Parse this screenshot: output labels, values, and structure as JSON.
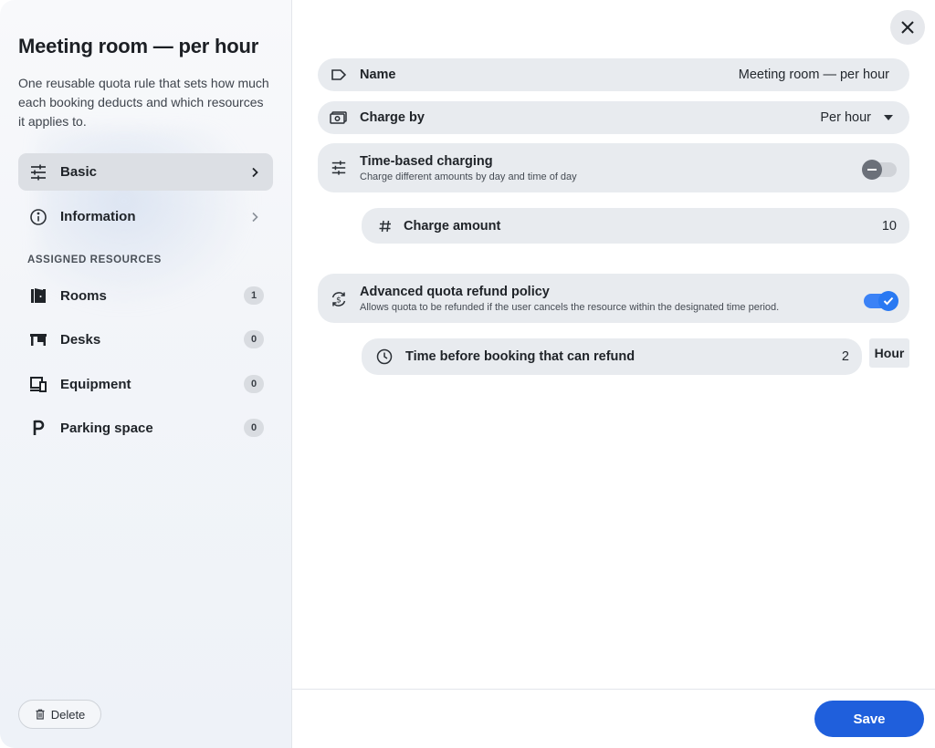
{
  "sidebar": {
    "title": "Meeting room — per hour",
    "description": "One reusable quota rule that sets how much each booking deducts and which resources it applies to.",
    "nav": [
      {
        "label": "Basic",
        "icon": "sliders-icon",
        "active": true
      },
      {
        "label": "Information",
        "icon": "info-icon",
        "active": false
      }
    ],
    "section_label": "ASSIGNED RESOURCES",
    "resources": [
      {
        "label": "Rooms",
        "count": "1",
        "icon": "door-icon"
      },
      {
        "label": "Desks",
        "count": "0",
        "icon": "desk-icon"
      },
      {
        "label": "Equipment",
        "count": "0",
        "icon": "devices-icon"
      },
      {
        "label": "Parking space",
        "count": "0",
        "icon": "parking-icon"
      }
    ],
    "delete_label": "Delete"
  },
  "form": {
    "name_label": "Name",
    "name_value": "Meeting room — per hour",
    "charge_by_label": "Charge by",
    "charge_by_value": "Per hour",
    "time_based_label": "Time-based charging",
    "time_based_desc": "Charge different amounts by day and time of day",
    "time_based_enabled": false,
    "charge_amount_label": "Charge amount",
    "charge_amount_value": "10",
    "refund_label": "Advanced quota refund policy",
    "refund_desc": "Allows quota to be refunded if the user cancels the resource within the designated time period.",
    "refund_enabled": true,
    "refund_time_label": "Time before booking that can refund",
    "refund_time_value": "2",
    "refund_time_unit": "Hour"
  },
  "footer": {
    "save_label": "Save"
  },
  "colors": {
    "accent": "#1f5fdc",
    "toggle_on": "#3b82f6",
    "row_bg": "#e8ebef"
  }
}
